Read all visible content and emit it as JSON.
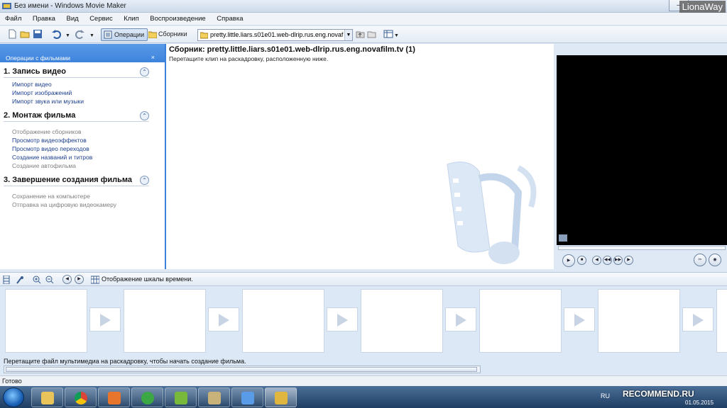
{
  "window": {
    "title": "Без имени - Windows Movie Maker",
    "watermark": "LionaWay"
  },
  "menu": [
    "Файл",
    "Правка",
    "Вид",
    "Сервис",
    "Клип",
    "Воспроизведение",
    "Справка"
  ],
  "toolbar": {
    "operations_label": "Операции",
    "collections_label": "Сборники",
    "collection_select_value": "pretty.little.liars.s01e01.web-dlrip.rus.eng.novaf"
  },
  "task_pane": {
    "header": "Операции с фильмами",
    "close_glyph": "×",
    "sections": [
      {
        "title": "1. Запись видео",
        "items": [
          {
            "label": "Импорт видео",
            "state": "link"
          },
          {
            "label": "Импорт изображений",
            "state": "link"
          },
          {
            "label": "Импорт звука или музыки",
            "state": "link"
          }
        ]
      },
      {
        "title": "2. Монтаж фильма",
        "items": [
          {
            "label": "Отображение сборников",
            "state": "disabled"
          },
          {
            "label": "Просмотр видеоэффектов",
            "state": "link"
          },
          {
            "label": "Просмотр видео переходов",
            "state": "link"
          },
          {
            "label": "Создание названий и титров",
            "state": "link"
          },
          {
            "label": "Создание автофильма",
            "state": "disabled"
          }
        ]
      },
      {
        "title": "3. Завершение создания фильма",
        "items": [
          {
            "label": "Сохранение на компьютере",
            "state": "disabled"
          },
          {
            "label": "Отправка на цифровую видеокамеру",
            "state": "disabled"
          }
        ]
      }
    ]
  },
  "collection": {
    "title": "Сборник: pretty.little.liars.s01e01.web-dlrip.rus.eng.novafilm.tv (1)",
    "subtitle": "Перетащите клип на раскадровку, расположенную ниже."
  },
  "storyboard": {
    "toolbar_label": "Отображение шкалы времени.",
    "hint": "Перетащите файл мультимедиа на раскадровку, чтобы начать создание фильма.",
    "frame_count": 6
  },
  "status": "Готово",
  "taskbar": {
    "language": "RU",
    "badge": "RECOMMEND.RU",
    "date": "01.05.2015"
  },
  "colors": {
    "accent_blue": "#3d83dc",
    "link": "#1b3f8d",
    "disabled": "#808080"
  }
}
